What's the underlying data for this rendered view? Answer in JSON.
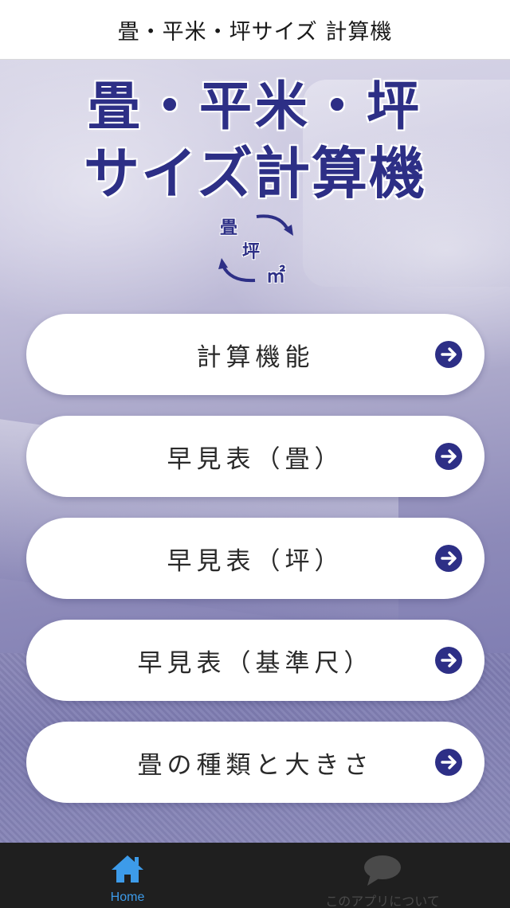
{
  "navbar": {
    "title": "畳・平米・坪サイズ 計算機"
  },
  "logo": {
    "line1": "畳・平米・坪",
    "line2": "サイズ計算機",
    "cycle": {
      "tatami": "畳",
      "tsubo": "坪",
      "sqm": "㎡"
    }
  },
  "menu": {
    "items": [
      {
        "label": "計算機能"
      },
      {
        "label": "早見表（畳）"
      },
      {
        "label": "早見表（坪）"
      },
      {
        "label": "早見表（基準尺）"
      },
      {
        "label": "畳の種類と大きさ"
      }
    ]
  },
  "tabbar": {
    "tabs": [
      {
        "label": "Home",
        "icon": "home-icon",
        "active": true
      },
      {
        "label": "このアプリについて",
        "icon": "chat-bubble-icon",
        "active": false
      }
    ]
  },
  "colors": {
    "brand": "#2d2f86",
    "tab_active": "#3d9be9",
    "tab_bar_bg": "#1f1f1f"
  }
}
